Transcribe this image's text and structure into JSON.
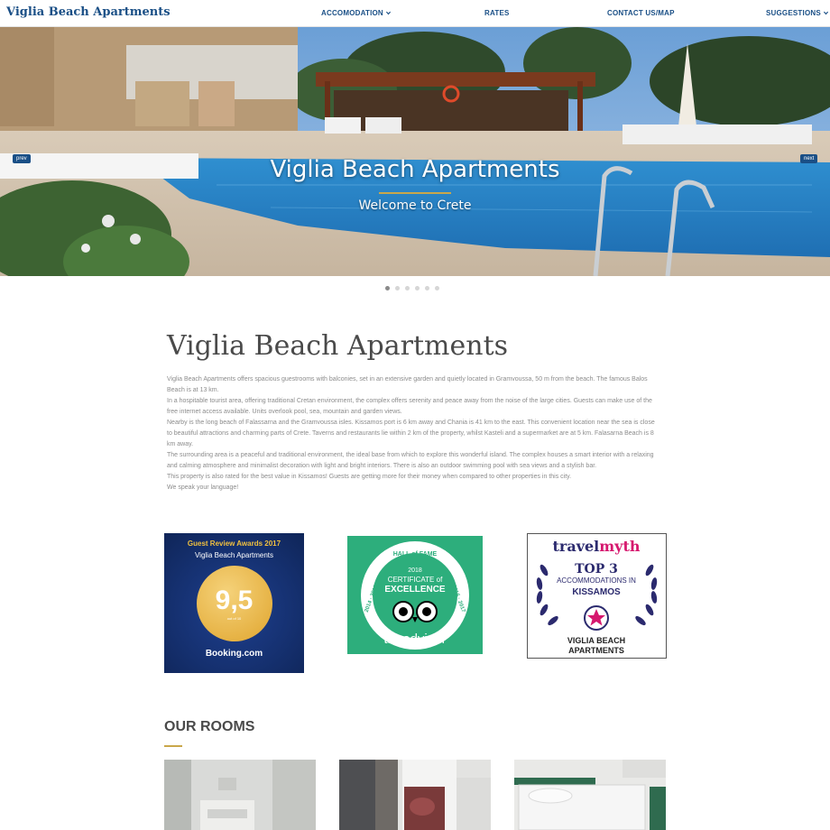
{
  "nav": {
    "brand": "Viglia Beach Apartments",
    "items": [
      {
        "label": "ACCOMODATION",
        "dropdown": true
      },
      {
        "label": "RATES",
        "dropdown": false
      },
      {
        "label": "CONTACT US/MAP",
        "dropdown": false
      },
      {
        "label": "SUGGESTIONS",
        "dropdown": true
      }
    ]
  },
  "hero": {
    "title": "Viglia Beach Apartments",
    "subtitle": "Welcome to Crete",
    "prev_label": "prev",
    "next_label": "next",
    "slides_count": 6,
    "active_slide": 1
  },
  "intro": {
    "title": "Viglia Beach Apartments",
    "paragraphs": [
      "Viglia Beach Apartments offers spacious guestrooms with balconies, set in an extensive garden and quietly located in Gramvoussa, 50 m from the beach. The famous Balos Beach is at 13 km.",
      "In a hospitable tourist area, offering traditional Cretan environment, the complex offers serenity and peace away from the noise of the large cities. Guests can make use of the free internet access available. Units overlook pool, sea, mountain and garden views.",
      "Nearby is the long beach of Falassarna and the Gramvoussa isles. Kissamos port is 6 km away and Chania is 41 km to the east. This convenient location near the sea is close to beautiful attractions and charming parts of Crete. Taverns and restaurants lie within 2 km of the property, whilst Kasteli and a supermarket are at 5 km. Falasarna Beach is 8 km away.",
      "The surrounding area is a peaceful and traditional environment, the ideal base from which to explore this wonderful island. The complex houses a smart interior with a relaxing and calming atmosphere and minimalist decoration with light and bright interiors. There is also an outdoor swimming pool with sea views and a stylish bar.",
      "This property is also rated for the best value in Kissamos! Guests are getting more for their money when compared to other properties in this city.",
      "We speak your language!"
    ]
  },
  "awards": {
    "booking": {
      "title": "Guest Review Awards 2017",
      "name": "Viglia Beach Apartments",
      "score": "9,5",
      "out_of": "out of 10",
      "brand": "Booking.com"
    },
    "tripadvisor": {
      "hall": "HALL of FAME",
      "year": "2018",
      "cert1": "CERTIFICATE of",
      "cert2": "EXCELLENCE",
      "years_left": "2014 · 2015",
      "years_right": "2016 · 2017",
      "brand_trip": "trip",
      "brand_advisor": "advisor"
    },
    "travelmyth": {
      "brand_travel": "travel",
      "brand_myth": "myth",
      "rank": "TOP 3",
      "line1": "ACCOMMODATIONS IN",
      "line2": "KISSAMOS",
      "name1": "VIGLIA BEACH",
      "name2": "APARTMENTS"
    }
  },
  "rooms": {
    "title": "OUR ROOMS"
  },
  "colors": {
    "brand_blue": "#1a4f86",
    "gold": "#c9a74a",
    "tripadvisor_green": "#2dae7c",
    "booking_blue": "#15306f",
    "travelmyth_pink": "#d6186e",
    "travelmyth_navy": "#2b2a6e"
  }
}
